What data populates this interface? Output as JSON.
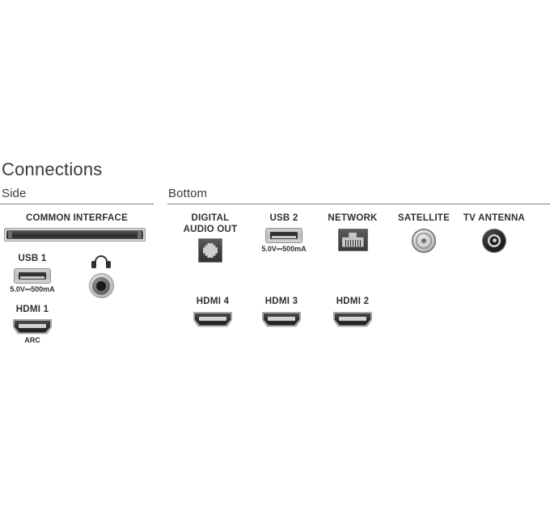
{
  "page": {
    "title": "Connections"
  },
  "sections": {
    "side": {
      "heading": "Side"
    },
    "bottom": {
      "heading": "Bottom"
    }
  },
  "side_ports": {
    "common_interface": {
      "label": "COMMON INTERFACE",
      "icon": "ci-slot-icon"
    },
    "usb1": {
      "label": "USB 1",
      "spec": "5.0V⎓500mA",
      "icon": "usb-port-icon"
    },
    "headphone": {
      "label": "",
      "icon": "headphone-icon"
    },
    "hdmi1": {
      "label": "HDMI 1",
      "sublabel": "ARC",
      "icon": "hdmi-port-icon"
    }
  },
  "bottom_ports": {
    "digital_audio_out": {
      "label": "DIGITAL\nAUDIO OUT",
      "line1": "DIGITAL",
      "line2": "AUDIO OUT",
      "icon": "optical-port-icon"
    },
    "usb2": {
      "label": "USB 2",
      "spec": "5.0V⎓500mA",
      "icon": "usb-port-icon"
    },
    "network": {
      "label": "NETWORK",
      "icon": "rj45-port-icon"
    },
    "satellite": {
      "label": "SATELLITE",
      "icon": "coax-satellite-icon"
    },
    "tv_antenna": {
      "label": "TV ANTENNA",
      "icon": "coax-antenna-icon"
    },
    "hdmi4": {
      "label": "HDMI 4",
      "icon": "hdmi-port-icon"
    },
    "hdmi3": {
      "label": "HDMI 3",
      "icon": "hdmi-port-icon"
    },
    "hdmi2": {
      "label": "HDMI 2",
      "icon": "hdmi-port-icon"
    }
  },
  "colors": {
    "background": "#ffffff",
    "text": "#2f2f2f",
    "heading": "#3a3a3a",
    "rule": "#7d7d7d",
    "metal_light": "#cfcfcf",
    "metal_dark": "#2c2c2c"
  }
}
